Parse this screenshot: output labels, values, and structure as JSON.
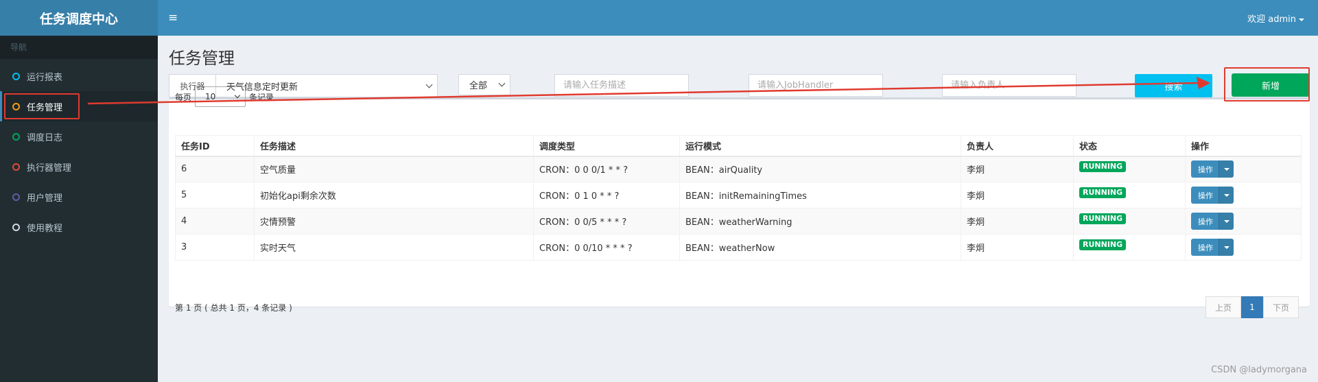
{
  "app": {
    "title": "任务调度中心"
  },
  "sidebar": {
    "header": "导航",
    "items": [
      {
        "label": "运行报表",
        "color": "#00c0ef"
      },
      {
        "label": "任务管理",
        "color": "#f39c12",
        "active": true
      },
      {
        "label": "调度日志",
        "color": "#00a65a"
      },
      {
        "label": "执行器管理",
        "color": "#dd4b39"
      },
      {
        "label": "用户管理",
        "color": "#605ca8"
      },
      {
        "label": "使用教程",
        "color": "#d2d6de"
      }
    ]
  },
  "topbar": {
    "toggle": "≡",
    "user": "欢迎 admin"
  },
  "page": {
    "title": "任务管理",
    "filters": {
      "executor_label": "执行器",
      "executor_value": "天气信息定时更新",
      "status_value": "全部",
      "desc_placeholder": "请输入任务描述",
      "handler_placeholder": "请输入JobHandler",
      "author_placeholder": "请输入负责人",
      "search_label": "搜索",
      "add_label": "新增"
    },
    "page_length": {
      "prefix": "每页",
      "value": "10",
      "suffix": "条记录"
    },
    "table": {
      "headers": [
        "任务ID",
        "任务描述",
        "调度类型",
        "运行模式",
        "负责人",
        "状态",
        "操作"
      ],
      "rows": [
        {
          "id": "6",
          "desc": "空气质量",
          "schedule": "CRON：0 0 0/1 * * ?",
          "mode": "BEAN：airQuality",
          "author": "李炯",
          "status": "RUNNING",
          "op": "操作"
        },
        {
          "id": "5",
          "desc": "初始化api剩余次数",
          "schedule": "CRON：0 1 0 * * ?",
          "mode": "BEAN：initRemainingTimes",
          "author": "李炯",
          "status": "RUNNING",
          "op": "操作"
        },
        {
          "id": "4",
          "desc": "灾情预警",
          "schedule": "CRON：0 0/5 * * * ?",
          "mode": "BEAN：weatherWarning",
          "author": "李炯",
          "status": "RUNNING",
          "op": "操作"
        },
        {
          "id": "3",
          "desc": "实时天气",
          "schedule": "CRON：0 0/10 * * * ?",
          "mode": "BEAN：weatherNow",
          "author": "李炯",
          "status": "RUNNING",
          "op": "操作"
        }
      ]
    },
    "info": "第 1 页 ( 总共 1 页，4 条记录 )",
    "pager": {
      "prev": "上页",
      "current": "1",
      "next": "下页"
    }
  },
  "watermark": "CSDN @ladymorgana",
  "colors": {
    "sidebar_bg": "#222d32",
    "header_bg": "#3c8dbc",
    "success": "#00a65a",
    "info": "#00c0ef",
    "annotation": "#e03a2e"
  }
}
